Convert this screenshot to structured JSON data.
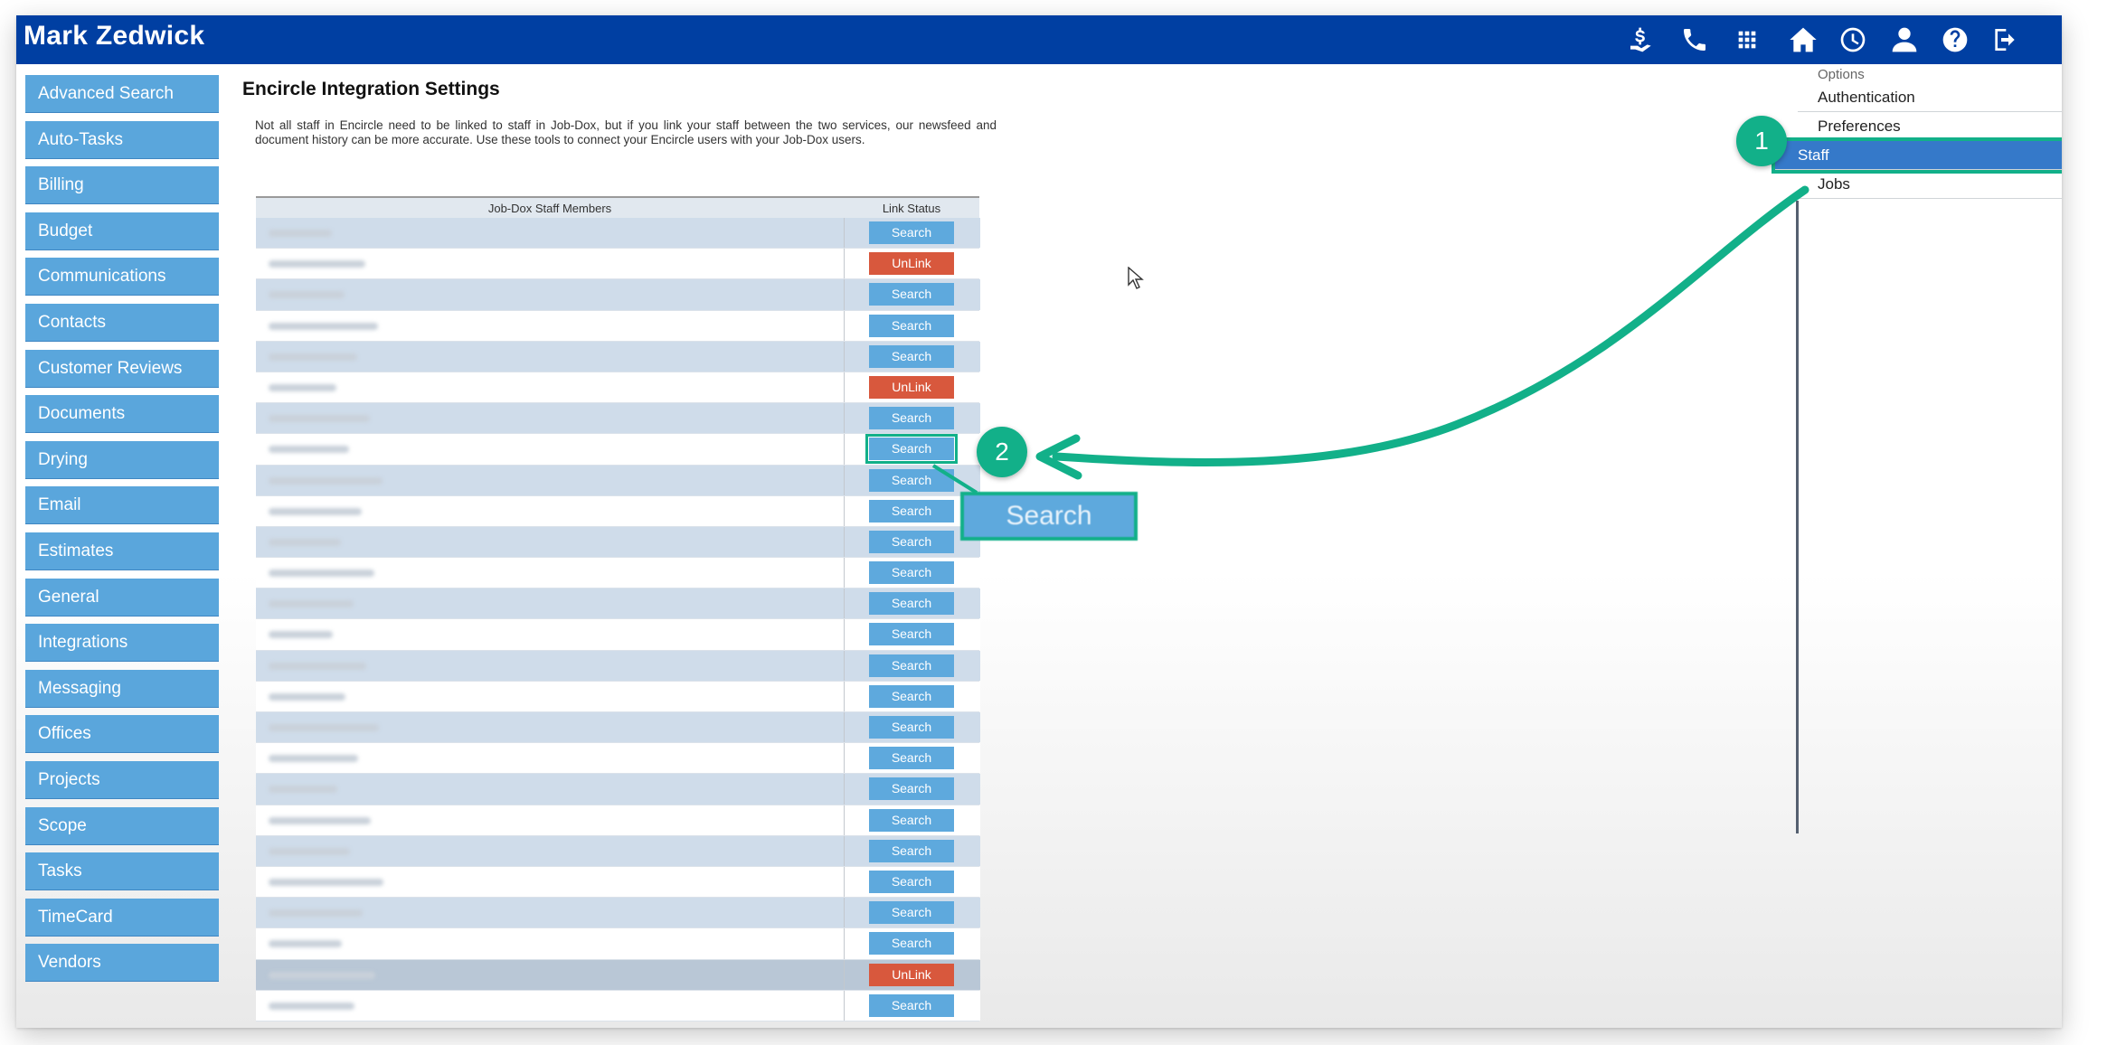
{
  "app": {
    "title": "Mark Zedwick"
  },
  "topbar_icons": [
    "money-hand-icon",
    "phone-icon",
    "apps-grid-icon",
    "home-icon",
    "clock-icon",
    "user-icon",
    "help-icon",
    "logout-icon"
  ],
  "sidebar": {
    "items": [
      {
        "label": "Advanced Search"
      },
      {
        "label": "Auto-Tasks"
      },
      {
        "label": "Billing"
      },
      {
        "label": "Budget"
      },
      {
        "label": "Communications"
      },
      {
        "label": "Contacts"
      },
      {
        "label": "Customer Reviews"
      },
      {
        "label": "Documents"
      },
      {
        "label": "Drying"
      },
      {
        "label": "Email"
      },
      {
        "label": "Estimates"
      },
      {
        "label": "General"
      },
      {
        "label": "Integrations"
      },
      {
        "label": "Messaging"
      },
      {
        "label": "Offices"
      },
      {
        "label": "Projects"
      },
      {
        "label": "Scope"
      },
      {
        "label": "Tasks"
      },
      {
        "label": "TimeCard"
      },
      {
        "label": "Vendors"
      }
    ]
  },
  "main": {
    "title": "Encircle Integration Settings",
    "description": "Not all staff in Encircle need to be linked to staff in Job-Dox, but if you link your staff between the two services, our newsfeed and document history can be more accurate. Use these tools to connect your Encircle users with your Job-Dox users.",
    "table": {
      "headers": {
        "members": "Job-Dox Staff Members",
        "status": "Link Status"
      },
      "rows": [
        {
          "action": "Search"
        },
        {
          "action": "UnLink"
        },
        {
          "action": "Search"
        },
        {
          "action": "Search"
        },
        {
          "action": "Search"
        },
        {
          "action": "UnLink"
        },
        {
          "action": "Search"
        },
        {
          "action": "Search"
        },
        {
          "action": "Search"
        },
        {
          "action": "Search"
        },
        {
          "action": "Search"
        },
        {
          "action": "Search"
        },
        {
          "action": "Search"
        },
        {
          "action": "Search"
        },
        {
          "action": "Search"
        },
        {
          "action": "Search"
        },
        {
          "action": "Search"
        },
        {
          "action": "Search"
        },
        {
          "action": "Search"
        },
        {
          "action": "Search"
        },
        {
          "action": "Search"
        },
        {
          "action": "Search"
        },
        {
          "action": "Search"
        },
        {
          "action": "Search"
        },
        {
          "action": "UnLink"
        },
        {
          "action": "Search"
        }
      ]
    }
  },
  "options": {
    "header": "Options",
    "items": [
      {
        "label": "Authentication"
      },
      {
        "label": "Preferences"
      },
      {
        "label": "Staff"
      },
      {
        "label": "Jobs"
      }
    ]
  },
  "annotations": {
    "badge1": "1",
    "badge2": "2",
    "zoom_label": "Search",
    "accent": "#12b089"
  },
  "colors": {
    "topbar": "#003fa2",
    "sidebar_button": "#5aa6dc",
    "search_button": "#5ea9dd",
    "unlink_button": "#d8583d",
    "active_option": "#3579c9"
  }
}
